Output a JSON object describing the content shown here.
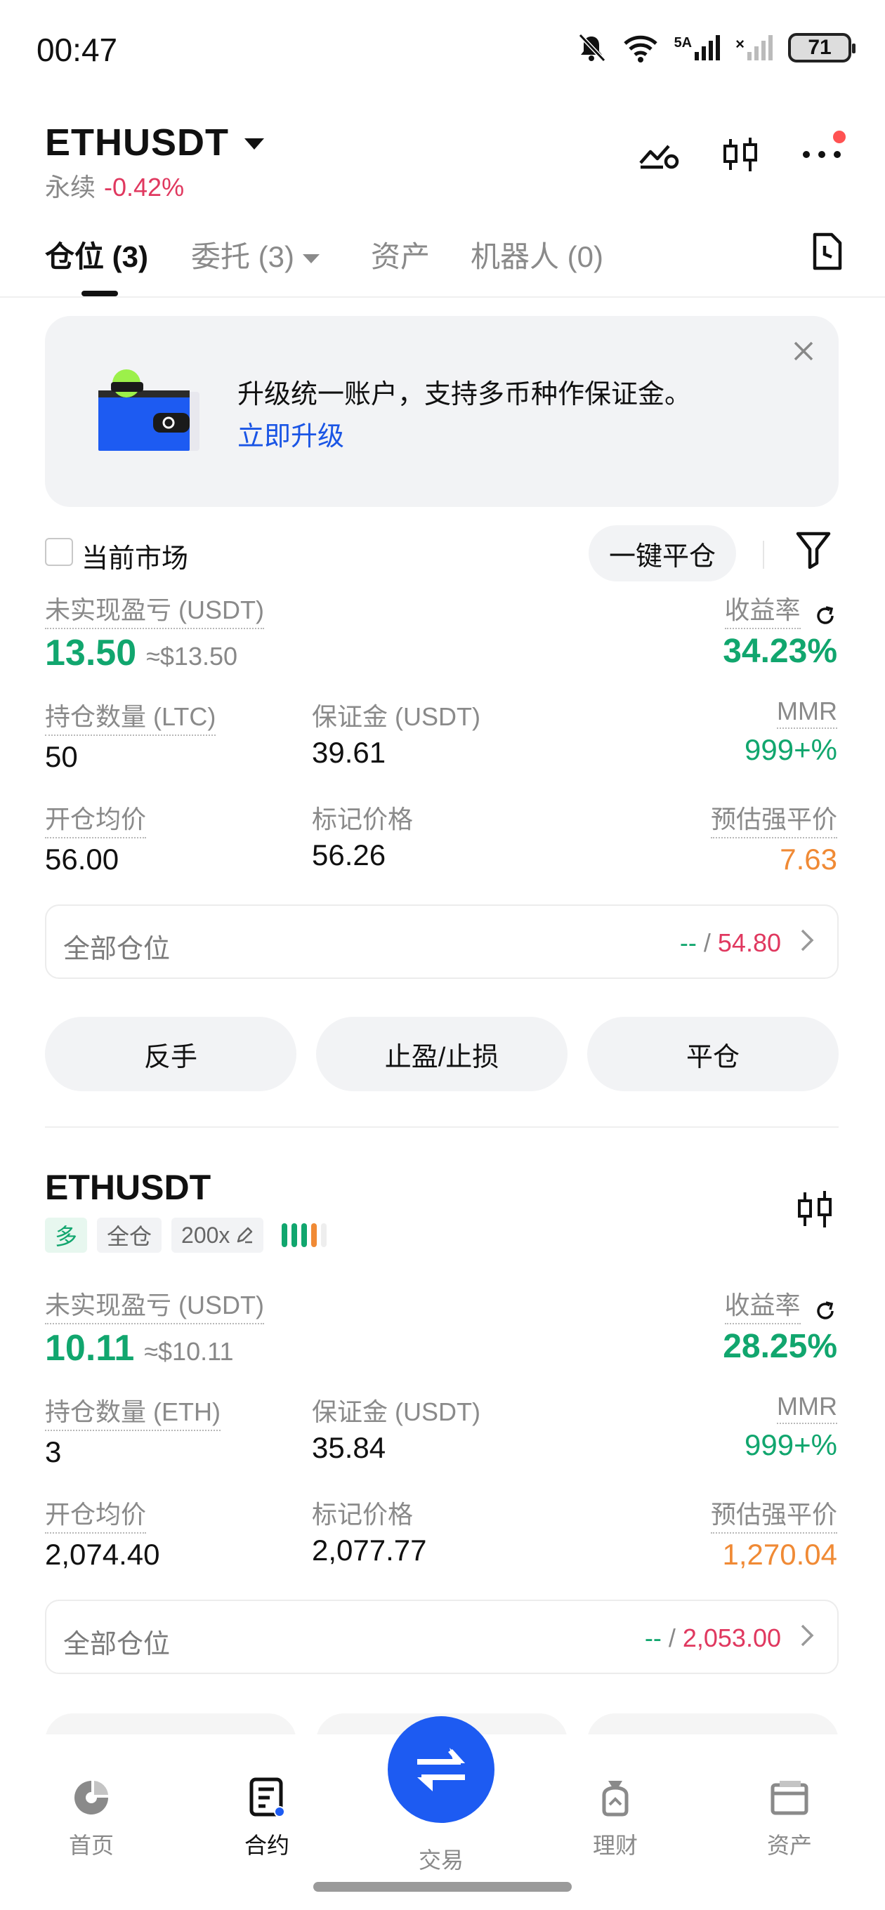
{
  "status": {
    "time": "00:47",
    "network_label": "5A",
    "battery": "71"
  },
  "header": {
    "pair": "ETHUSDT",
    "type": "永续",
    "change": "-0.42%"
  },
  "tabs": [
    {
      "label": "仓位 (3)"
    },
    {
      "label": "委托 (3)"
    },
    {
      "label": "资产"
    },
    {
      "label": "机器人 (0)"
    }
  ],
  "banner": {
    "text": "升级统一账户，支持多币种作保证金。",
    "link": "立即升级"
  },
  "filter": {
    "current_market": "当前市场",
    "close_all": "一键平仓"
  },
  "positions": [
    {
      "pnl_label": "未实现盈亏 (USDT)",
      "pnl": "13.50",
      "pnl_usd": "≈$13.50",
      "roe_label": "收益率",
      "roe": "34.23%",
      "qty_label": "持仓数量 (LTC)",
      "qty": "50",
      "margin_label": "保证金 (USDT)",
      "margin": "39.61",
      "mmr_label": "MMR",
      "mmr": "999+%",
      "entry_label": "开仓均价",
      "entry": "56.00",
      "mark_label": "标记价格",
      "mark": "56.26",
      "liq_label": "预估强平价",
      "liq": "7.63",
      "all_label": "全部仓位",
      "all_tp": "--",
      "all_sep": "/",
      "all_sl": "54.80",
      "btn_reverse": "反手",
      "btn_tpsl": "止盈/止损",
      "btn_close": "平仓"
    },
    {
      "title": "ETHUSDT",
      "tag_side": "多",
      "tag_mode": "全仓",
      "tag_leverage": "200x",
      "pnl_label": "未实现盈亏 (USDT)",
      "pnl": "10.11",
      "pnl_usd": "≈$10.11",
      "roe_label": "收益率",
      "roe": "28.25%",
      "qty_label": "持仓数量 (ETH)",
      "qty": "3",
      "margin_label": "保证金 (USDT)",
      "margin": "35.84",
      "mmr_label": "MMR",
      "mmr": "999+%",
      "entry_label": "开仓均价",
      "entry": "2,074.40",
      "mark_label": "标记价格",
      "mark": "2,077.77",
      "liq_label": "预估强平价",
      "liq": "1,270.04",
      "all_label": "全部仓位",
      "all_tp": "--",
      "all_sep": "/",
      "all_sl": "2,053.00"
    }
  ],
  "nav": [
    {
      "label": "首页",
      "icon": "home-icon"
    },
    {
      "label": "合约",
      "icon": "contract-icon"
    },
    {
      "label": "交易",
      "icon": "swap-icon"
    },
    {
      "label": "理财",
      "icon": "wealth-icon"
    },
    {
      "label": "资产",
      "icon": "wallet-icon"
    }
  ],
  "colors": {
    "green": "#11a66e",
    "red": "#e0385f",
    "orange": "#f08a35",
    "blue": "#1d5bf2"
  }
}
